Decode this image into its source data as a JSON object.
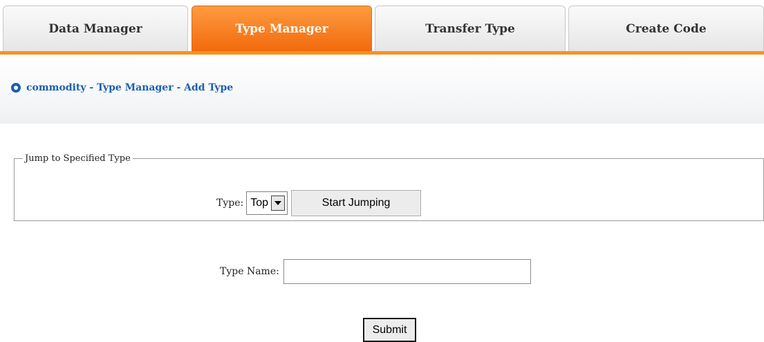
{
  "tabs": [
    {
      "label": "Data Manager",
      "active": false
    },
    {
      "label": "Type Manager",
      "active": true
    },
    {
      "label": "Transfer Type",
      "active": false
    },
    {
      "label": "Create Code",
      "active": false
    }
  ],
  "breadcrumb": {
    "icon": "radio-bullet-icon",
    "text": "commodity - Type Manager - Add Type"
  },
  "jump_section": {
    "legend": "Jump to Specified Type",
    "type_label": "Type:",
    "type_value": "Top",
    "jump_button": "Start Jumping"
  },
  "form": {
    "name_label": "Type Name:",
    "name_value": "",
    "submit_label": "Submit"
  },
  "colors": {
    "accent": "#f7931e",
    "active_tab": "#f26a0c",
    "link": "#1a5fae"
  }
}
